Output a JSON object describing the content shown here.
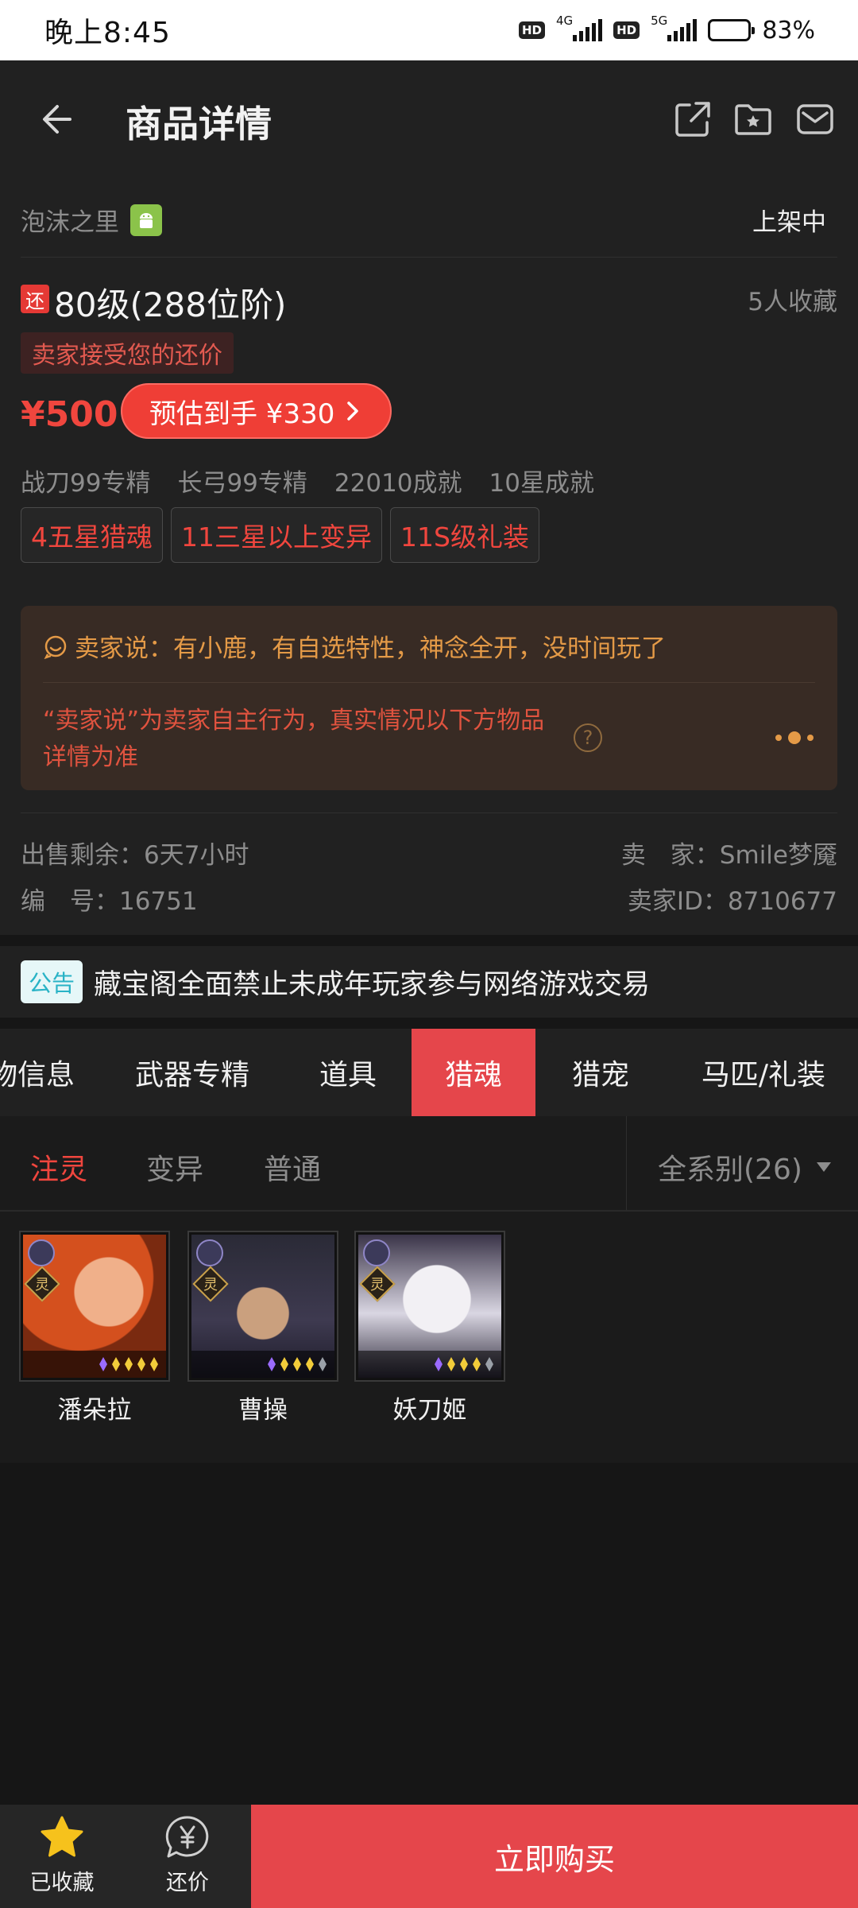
{
  "status_bar": {
    "time": "晚上8:45",
    "network1": "4G",
    "network2": "5G",
    "hd_label": "HD",
    "battery_percent": "83%",
    "battery_level": 0.83
  },
  "nav": {
    "title": "商品详情",
    "icons": [
      "back-arrow-icon",
      "share-icon",
      "favorite-folder-icon",
      "mail-icon"
    ]
  },
  "item": {
    "server": "泡沫之里",
    "platform_icon": "android-icon",
    "status": "上架中",
    "bargain_badge": "还",
    "title": "80级(288位阶)",
    "favorites": "5人收藏",
    "offer_tag": "卖家接受您的还价",
    "price": "¥500",
    "estimate": "预估到手 ¥330",
    "specs": [
      "战刀99专精",
      "长弓99专精",
      "22010成就",
      "10星成就"
    ],
    "tags": [
      "4五星猎魂",
      "11三星以上变异",
      "11S级礼装"
    ]
  },
  "seller_box": {
    "says": "卖家说：有小鹿，有自选特性，神念全开，没时间玩了",
    "disclaimer": "“卖家说”为卖家自主行为，真实情况以下方物品详情为准"
  },
  "meta": {
    "remaining": "出售剩余：6天7小时",
    "seller": "卖　家：Smile梦魇",
    "number": "编　号：16751",
    "seller_id": "卖家ID：8710677"
  },
  "notice": {
    "tag": "公告",
    "text": "藏宝阁全面禁止未成年玩家参与网络游戏交易"
  },
  "tabs": [
    {
      "label": "物信息"
    },
    {
      "label": "武器专精"
    },
    {
      "label": "道具"
    },
    {
      "label": "猎魂",
      "active": true
    },
    {
      "label": "猎宠"
    },
    {
      "label": "马匹/礼装"
    }
  ],
  "subtabs": [
    {
      "label": "注灵",
      "active": true
    },
    {
      "label": "变异"
    },
    {
      "label": "普通"
    }
  ],
  "series_filter": "全系别(26)",
  "spirits": [
    {
      "name": "潘朵拉",
      "badge": "灵"
    },
    {
      "name": "曹操",
      "badge": "灵"
    },
    {
      "name": "妖刀姬",
      "badge": "灵"
    }
  ],
  "bottom": {
    "favorited": "已收藏",
    "bargain": "还价",
    "buy": "立即购买"
  },
  "colors": {
    "accent": "#e5464b",
    "price": "#f0463e",
    "seller_text": "#e49a47",
    "notice": "#29b3c6"
  }
}
